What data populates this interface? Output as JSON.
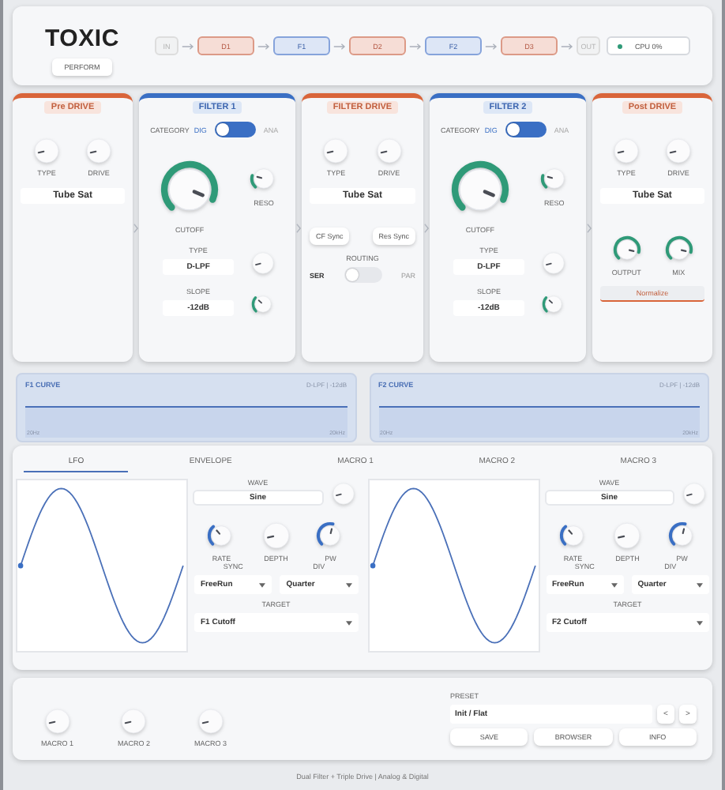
{
  "header": {
    "title": "TOXIC",
    "mode_button": "PERFORM",
    "cpu": "CPU 0%",
    "chain": [
      {
        "label": "IN",
        "kind": "io"
      },
      {
        "label": "D1",
        "kind": "drive"
      },
      {
        "label": "F1",
        "kind": "filter"
      },
      {
        "label": "D2",
        "kind": "drive"
      },
      {
        "label": "F2",
        "kind": "filter"
      },
      {
        "label": "D3",
        "kind": "drive"
      },
      {
        "label": "OUT",
        "kind": "io"
      }
    ]
  },
  "modules": [
    {
      "kind": "drive",
      "title": "Pre DRIVE",
      "knobs": [
        {
          "label": "TYPE"
        },
        {
          "label": "DRIVE"
        }
      ],
      "mode": "Tube Sat"
    },
    {
      "kind": "filter",
      "title": "FILTER 1",
      "category_label": "CATEGORY",
      "category": [
        {
          "label": "DIG",
          "selected": true
        },
        {
          "label": "ANA",
          "selected": false
        }
      ],
      "cutoff": {
        "label": "CUTOFF"
      },
      "reso": {
        "label": "RESO"
      },
      "type": {
        "label": "TYPE",
        "value": "D-LPF"
      },
      "slope": {
        "label": "SLOPE",
        "value": "-12dB"
      }
    },
    {
      "kind": "filter_drive",
      "title": "FILTER DRIVE",
      "knobs": [
        {
          "label": "TYPE"
        },
        {
          "label": "DRIVE"
        }
      ],
      "mode": "Tube Sat",
      "sync_buttons": [
        "CF Sync",
        "Res Sync"
      ],
      "routing_label": "ROUTING",
      "routing": [
        {
          "label": "SER",
          "selected": true
        },
        {
          "label": "PAR",
          "selected": false
        }
      ]
    },
    {
      "kind": "filter",
      "title": "FILTER 2",
      "category_label": "CATEGORY",
      "category": [
        {
          "label": "DIG",
          "selected": true
        },
        {
          "label": "ANA",
          "selected": false
        }
      ],
      "cutoff": {
        "label": "CUTOFF"
      },
      "reso": {
        "label": "RESO"
      },
      "type": {
        "label": "TYPE",
        "value": "D-LPF"
      },
      "slope": {
        "label": "SLOPE",
        "value": "-12dB"
      }
    },
    {
      "kind": "post",
      "title": "Post DRIVE",
      "knobs": [
        {
          "label": "TYPE"
        },
        {
          "label": "DRIVE"
        }
      ],
      "mode": "Tube Sat",
      "outputs": [
        {
          "label": "OUTPUT"
        },
        {
          "label": "MIX"
        }
      ],
      "button": "Normalize"
    }
  ],
  "curves": [
    {
      "title": "F1 CURVE",
      "info": "D-LPF | -12dB",
      "min": "20Hz",
      "max": "20kHz"
    },
    {
      "title": "F2 CURVE",
      "info": "D-LPF | -12dB",
      "min": "20Hz",
      "max": "20kHz"
    }
  ],
  "mod_tabs": [
    {
      "label": "LFO",
      "selected": true
    },
    {
      "label": "ENVELOPE",
      "selected": false
    },
    {
      "label": "MACRO 1",
      "selected": false
    },
    {
      "label": "MACRO 2",
      "selected": false
    },
    {
      "label": "MACRO 3",
      "selected": false
    }
  ],
  "lfos": [
    {
      "wave_label": "WAVE",
      "wave": "Sine",
      "knobs": [
        {
          "label": "RATE",
          "kind": "arc"
        },
        {
          "label": "DEPTH",
          "kind": "plain"
        },
        {
          "label": "PW",
          "kind": "arc"
        }
      ],
      "sync_label": "SYNC",
      "sync": "FreeRun",
      "div_label": "DIV",
      "div": "Quarter",
      "target_label": "TARGET",
      "target": "F1 Cutoff"
    },
    {
      "wave_label": "WAVE",
      "wave": "Sine",
      "knobs": [
        {
          "label": "RATE",
          "kind": "arc"
        },
        {
          "label": "DEPTH",
          "kind": "plain"
        },
        {
          "label": "PW",
          "kind": "arc"
        }
      ],
      "sync_label": "SYNC",
      "sync": "FreeRun",
      "div_label": "DIV",
      "div": "Quarter",
      "target_label": "TARGET",
      "target": "F2 Cutoff"
    }
  ],
  "macros": [
    {
      "label": "MACRO 1"
    },
    {
      "label": "MACRO 2"
    },
    {
      "label": "MACRO 3"
    }
  ],
  "preset": {
    "label": "PRESET",
    "name": "Init / Flat",
    "prev": "<",
    "next": ">",
    "buttons": [
      "SAVE",
      "BROWSER",
      "INFO"
    ]
  },
  "footer": "Dual Filter + Triple Drive | Analog & Digital"
}
